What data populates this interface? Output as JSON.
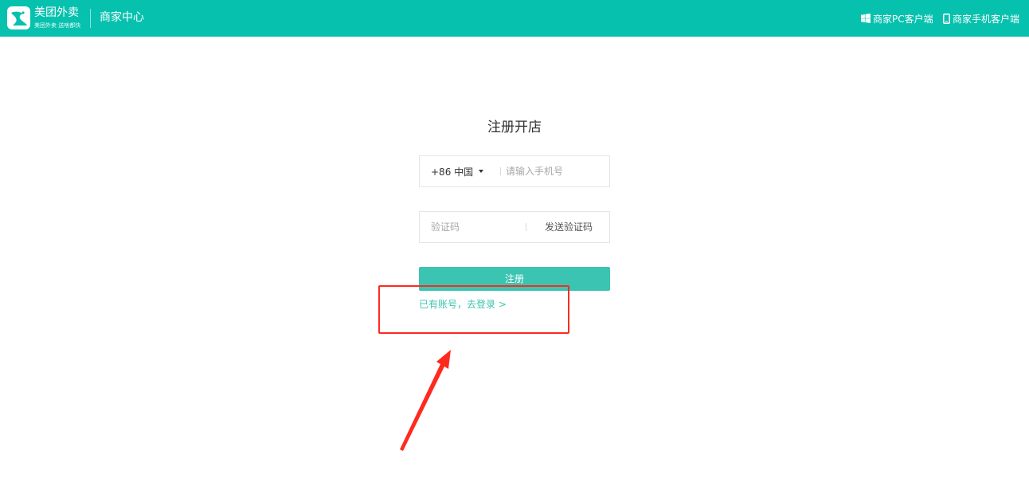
{
  "header": {
    "brand_name": "美团外卖",
    "brand_slogan": "美团外卖  送啥都快",
    "section_title": "商家中心",
    "links": [
      {
        "label": "商家PC客户端",
        "icon": "windows-icon"
      },
      {
        "label": "商家手机客户端",
        "icon": "mobile-phone-icon"
      }
    ]
  },
  "form": {
    "title": "注册开店",
    "country_code": "+86 中国",
    "phone_placeholder": "请输入手机号",
    "code_placeholder": "验证码",
    "send_code_label": "发送验证码",
    "submit_label": "注册",
    "login_link": "已有账号，去登录 >"
  },
  "colors": {
    "brand": "#06c1ae",
    "button": "#3cc4b2",
    "annotation": "#ff2a1e"
  }
}
